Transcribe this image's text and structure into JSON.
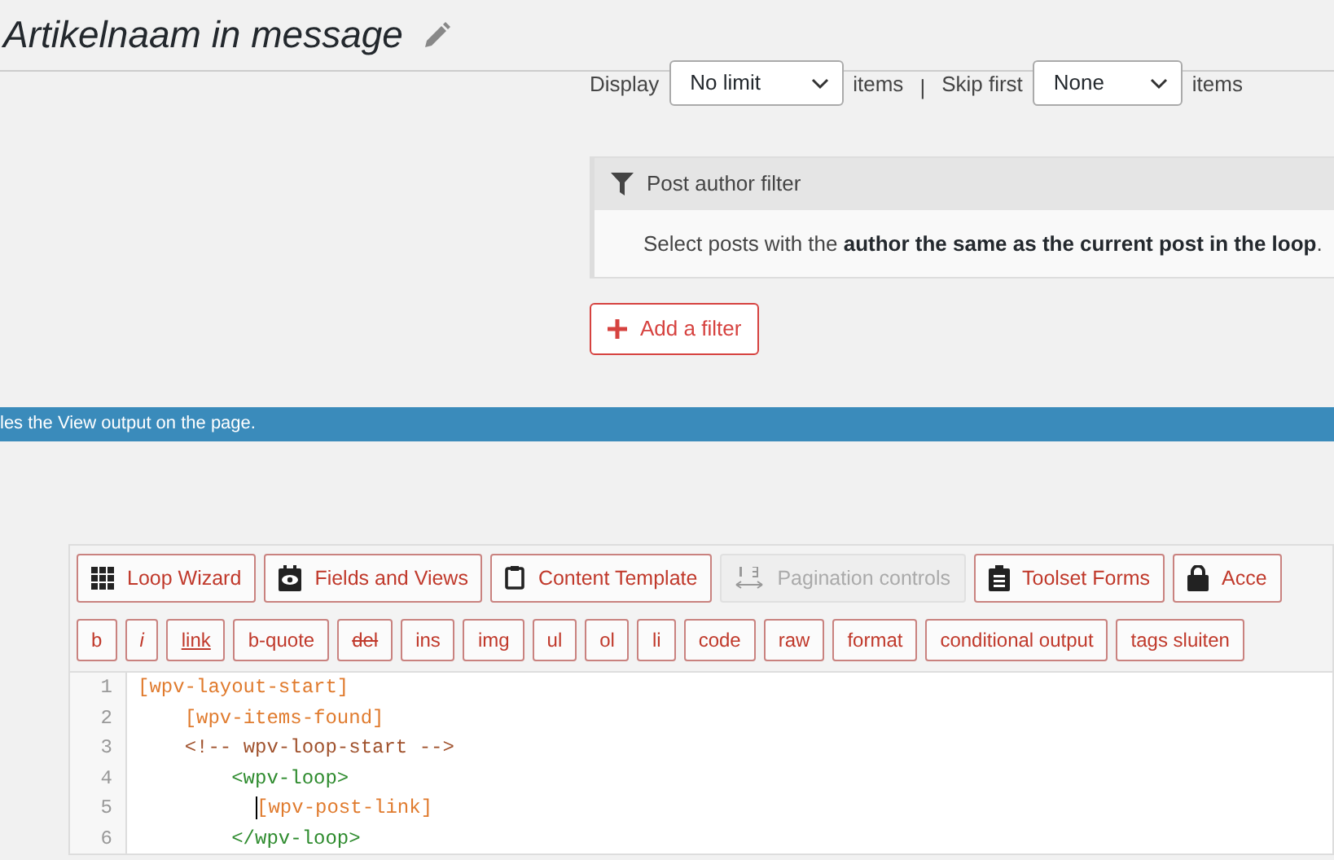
{
  "header": {
    "title": "Artikelnaam in message"
  },
  "limits": {
    "display_label": "Display",
    "display_value": "No limit",
    "display_suffix": "items",
    "separator": "|",
    "skip_label": "Skip first",
    "skip_value": "None",
    "skip_suffix": "items"
  },
  "filter_panel": {
    "title": "Post author filter",
    "description": "Select posts with the **author the same as the current post in the loop**."
  },
  "add_filter": {
    "label": "Add a filter"
  },
  "info_bar": {
    "text": "les the View output on the page."
  },
  "toolbar": [
    {
      "label": "Loop Wizard",
      "kind": "grid",
      "disabled": false
    },
    {
      "label": "Fields and Views",
      "kind": "eye",
      "disabled": false
    },
    {
      "label": "Content Template",
      "kind": "clipboard",
      "disabled": false
    },
    {
      "label": "Pagination controls",
      "kind": "pagination",
      "disabled": true
    },
    {
      "label": "Toolset Forms",
      "kind": "form",
      "disabled": false
    },
    {
      "label": "Acce",
      "kind": "lock",
      "disabled": false
    }
  ],
  "format_buttons": [
    {
      "label": "b",
      "kind": "plain"
    },
    {
      "label": "i",
      "kind": "italic"
    },
    {
      "label": "link",
      "kind": "underline"
    },
    {
      "label": "b-quote",
      "kind": "plain"
    },
    {
      "label": "del",
      "kind": "strike"
    },
    {
      "label": "ins",
      "kind": "plain"
    },
    {
      "label": "img",
      "kind": "plain"
    },
    {
      "label": "ul",
      "kind": "plain"
    },
    {
      "label": "ol",
      "kind": "plain"
    },
    {
      "label": "li",
      "kind": "plain"
    },
    {
      "label": "code",
      "kind": "plain"
    },
    {
      "label": "raw",
      "kind": "plain"
    },
    {
      "label": "format",
      "kind": "plain"
    },
    {
      "label": "conditional output",
      "kind": "plain"
    },
    {
      "label": "tags sluiten",
      "kind": "plain"
    }
  ],
  "editor": {
    "lines": [
      {
        "number": "1",
        "text": "[wpv-layout-start]",
        "kind": "shortcode",
        "cursor": false
      },
      {
        "number": "2",
        "text": "    [wpv-items-found]",
        "kind": "shortcode",
        "cursor": false
      },
      {
        "number": "3",
        "text": "    <!-- wpv-loop-start -->",
        "kind": "comment",
        "cursor": false
      },
      {
        "number": "4",
        "text": "        <wpv-loop>",
        "kind": "tag",
        "cursor": false
      },
      {
        "number": "5",
        "text": "          [wpv-post-link]",
        "kind": "shortcode",
        "cursor": true
      },
      {
        "number": "6",
        "text": "        </wpv-loop>",
        "kind": "tag",
        "cursor": false
      }
    ]
  }
}
